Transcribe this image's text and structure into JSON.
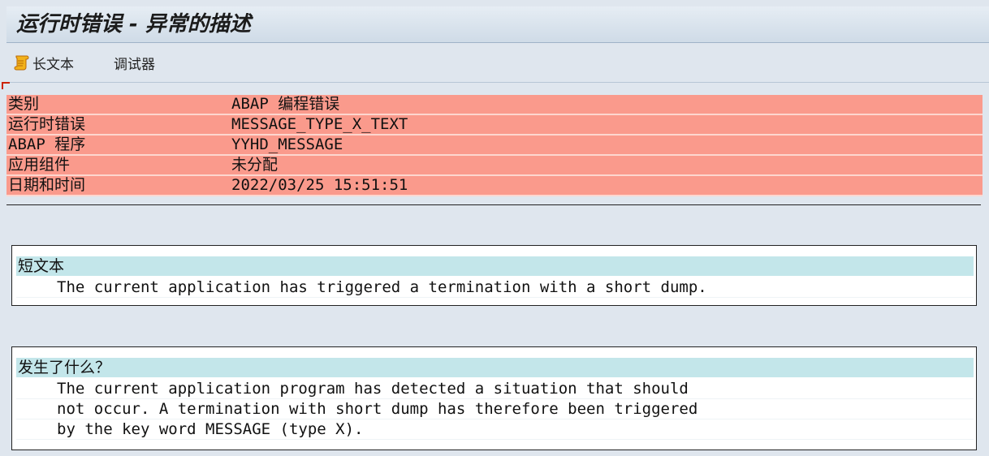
{
  "window": {
    "title": "运行时错误 - 异常的描述"
  },
  "toolbar": {
    "long_text_label": "长文本",
    "long_text_icon": "scroll-icon",
    "debugger_label": "调试器"
  },
  "info": {
    "rows": [
      {
        "key": "类别",
        "value": "ABAP 编程错误"
      },
      {
        "key": "运行时错误",
        "value": "MESSAGE_TYPE_X_TEXT"
      },
      {
        "key": "ABAP 程序",
        "value": "YYHD_MESSAGE"
      },
      {
        "key": "应用组件",
        "value": "未分配"
      },
      {
        "key": "日期和时间",
        "value": "2022/03/25 15:51:51"
      }
    ],
    "row_color": "#fa9a8c"
  },
  "short_text": {
    "heading": "短文本",
    "lines": [
      "The current application has triggered a termination with a short dump."
    ]
  },
  "what_happened": {
    "heading": "发生了什么？",
    "lines": [
      "The current application program has detected a situation that should",
      "not occur. A termination with short dump has therefore been triggered",
      "by the key word MESSAGE (type X)."
    ]
  },
  "colors": {
    "section_header": "#c3e6ea",
    "background": "#dfe6ee"
  }
}
